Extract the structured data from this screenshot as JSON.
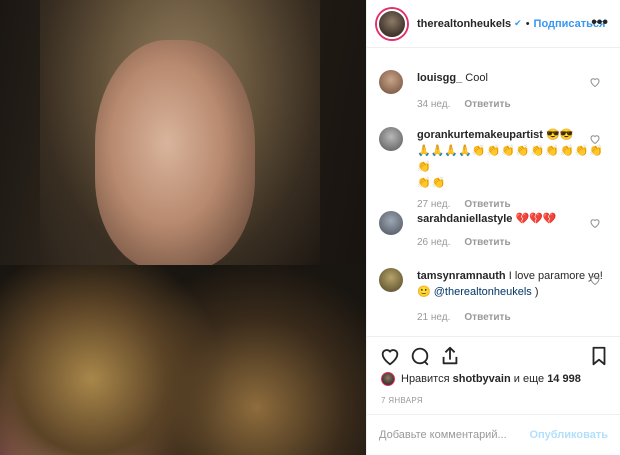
{
  "post": {
    "username": "therealtonheukels",
    "verified_glyph": "✔",
    "separator": "•",
    "follow_label": "Подписаться",
    "more_glyph": "•••"
  },
  "comments": [
    {
      "user": "louisgg_",
      "text": "Cool",
      "age": "34 нед.",
      "reply": "Ответить"
    },
    {
      "user": "gorankurtemakeupartist",
      "text_emoji": "😎😎",
      "line2_blue": "🙏🙏🙏🙏",
      "line2_hands": "👏👏👏👏👏👏👏👏👏👏",
      "line3_hands": "👏👏",
      "age": "27 нед.",
      "reply": "Ответить"
    },
    {
      "user": "sarahdaniellastyle",
      "text": "💔💔💔",
      "age": "26 нед.",
      "reply": "Ответить"
    },
    {
      "user": "tamsynramnauth",
      "text": "I love paramore yo!🙂",
      "mention": "@therealtonheukels",
      "tail": ")",
      "age": "21 нед.",
      "reply": "Ответить"
    }
  ],
  "likes": {
    "prefix": "Нравится",
    "user": "shotbyvain",
    "middle": "и еще",
    "count": "14 998"
  },
  "date": "7 ЯНВАРЯ",
  "add_comment": {
    "placeholder": "Добавьте комментарий...",
    "post_label": "Опубликовать"
  }
}
